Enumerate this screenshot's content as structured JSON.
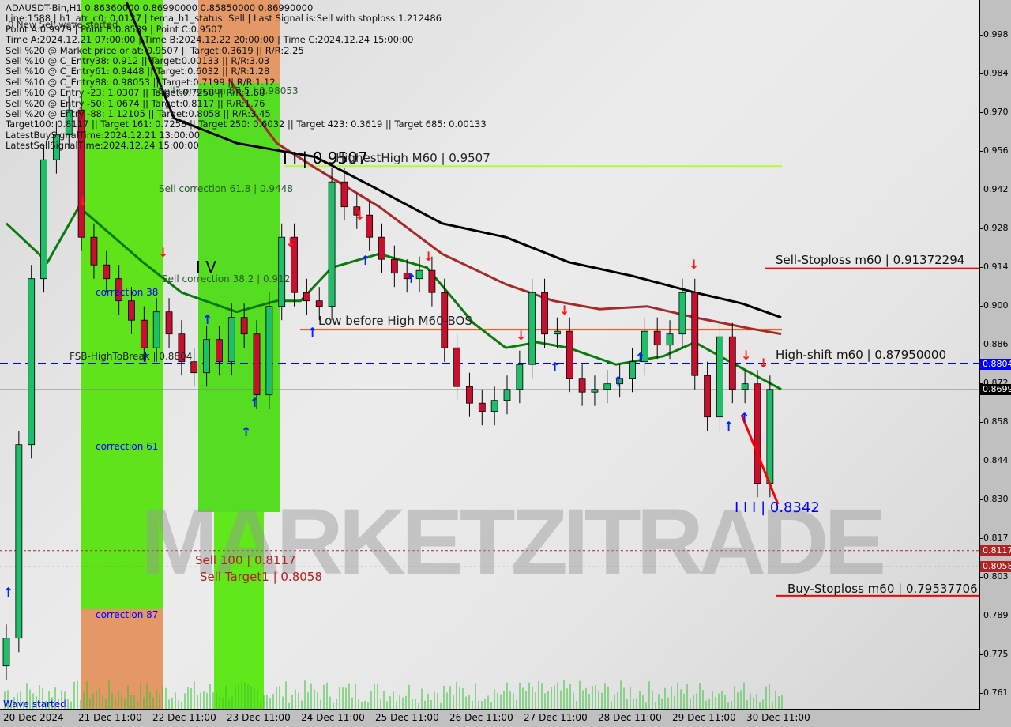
{
  "info_panel": [
    "ADAUSDT-Bin,H1  0.86360000 0.86990000 0.85850000 0.86990000",
    "Line:1588 | h1_atr_c0: 0.0127 | tema_h1_status: Sell | Last Signal is:Sell with stoploss:1.212486",
    "Point A:0.9979 | Point B:0.8589 | Point C:0.9507",
    "Time A:2024.12.21 07:00:00 | Time B:2024.12.22 20:00:00 | Time C:2024.12.24 15:00:00",
    "Sell %20 @ Market price or at: 0.9507 || Target:0.3619 || R/R:2.25",
    "Sell %10 @ C_Entry38: 0.912 || Target:0.00133 || R/R:3.03",
    "Sell %10 @ C_Entry61: 0.9448 || Target:0.6032 || R/R:1.28",
    "Sell %10 @ C_Entry88: 0.98053 || Target:0.7199 || R/R:1.12",
    "Sell %10 @ Entry -23: 1.0307 || Target:0.7258 || R/R:1.68",
    "Sell %20 @ Entry -50: 1.0674 || Target:0.8117 || R/R:1.76",
    "Sell %20 @ Entry -88: 1.12105 || Target:0.8058 || R/R:3.45",
    "Target100: 0.8117 || Target 161: 0.7258 || Target 250: 0.6032 || Target 423: 0.3619 || Target 685: 0.00133",
    "LatestBuySignalTime:2024.12.21 13:00:00",
    "LatestSellSignalTime:2024.12.24 15:00:00"
  ],
  "overlay_labels": {
    "new_sell_wave": "0 New Sell wave started",
    "sell_correction_88": "Sell correction 87.5 | 0.98053",
    "sell_correction_618": "Sell correction 61.8 | 0.9448",
    "sell_correction_382": "Sell correction 38.2 | 0.912",
    "correction_38": "correction 38",
    "correction_61": "correction 61",
    "correction_87": "correction 87",
    "wave_started": "Wave started",
    "fsb_high": "FSB-HighToBreak | 0.8804",
    "wave_iv": "I V",
    "point_c": "I I | 0.9507",
    "highest_high": "HighestHigh   M60 | 0.9507",
    "low_before_high": "Low before High   M60-BOS",
    "sell_stoploss": "Sell-Stoploss m60 | 0.91372294",
    "high_shift": "High-shift m60 | 0.87950000",
    "buy_stoploss": "Buy-Stoploss m60 | 0.79537706",
    "sell_100": "Sell 100 | 0.8117",
    "sell_target1": "Sell Target1 | 0.8058",
    "wave_iii": "I I I | 0.8342",
    "watermark": "MARKETZITRADE"
  },
  "price_badges": {
    "high_shift": "0.8804",
    "current": "0.8699",
    "sell_100": "0.8117",
    "sell_target1": "0.8058"
  },
  "colors": {
    "bull": "#1fbf6a",
    "bear": "#c8102e",
    "ma_fast": "#0a7a0a",
    "ma_mid": "#a52a2a",
    "ma_slow": "#000000",
    "zone_green": "#5fe31a",
    "zone_orange": "#e39866",
    "stoploss": "#ff0000",
    "high_shift": "#0000ff",
    "bos": "#ff4500",
    "m60": "#adff2f",
    "target": "#b22222"
  },
  "chart_data": {
    "type": "candlestick",
    "symbol": "ADAUSDT-Bin",
    "timeframe": "H1",
    "ylim": [
      0.761,
      1.005
    ],
    "y_ticks": [
      "0.998",
      "0.984",
      "0.970",
      "0.956",
      "0.942",
      "0.928",
      "0.914",
      "0.900",
      "0.886",
      "0.872",
      "0.858",
      "0.844",
      "0.830",
      "0.817",
      "0.803",
      "0.789",
      "0.775",
      "0.761"
    ],
    "x_ticks": [
      "20 Dec 2024",
      "21 Dec 11:00",
      "22 Dec 11:00",
      "23 Dec 11:00",
      "24 Dec 11:00",
      "25 Dec 11:00",
      "26 Dec 11:00",
      "27 Dec 11:00",
      "28 Dec 11:00",
      "29 Dec 11:00",
      "30 Dec 11:00"
    ],
    "closes": [
      0.78,
      0.85,
      0.91,
      0.953,
      0.962,
      0.971,
      0.925,
      0.915,
      0.91,
      0.902,
      0.895,
      0.885,
      0.898,
      0.89,
      0.88,
      0.876,
      0.888,
      0.88,
      0.896,
      0.89,
      0.868,
      0.9,
      0.925,
      0.905,
      0.902,
      0.9,
      0.945,
      0.936,
      0.933,
      0.925,
      0.917,
      0.912,
      0.91,
      0.913,
      0.905,
      0.885,
      0.871,
      0.865,
      0.862,
      0.866,
      0.87,
      0.879,
      0.905,
      0.89,
      0.891,
      0.874,
      0.869,
      0.87,
      0.872,
      0.874,
      0.88,
      0.891,
      0.886,
      0.89,
      0.905,
      0.875,
      0.86,
      0.889,
      0.87,
      0.872,
      0.836,
      0.87
    ],
    "last_ohlc": {
      "open": 0.8636,
      "high": 0.8699,
      "low": 0.8585,
      "close": 0.8699
    },
    "moving_averages": [
      {
        "color": "#0a7a0a",
        "points": [
          [
            0,
            0.93
          ],
          [
            3.3,
            0.916
          ],
          [
            5.8,
            0.936
          ],
          [
            10.9,
            0.916
          ],
          [
            14,
            0.905
          ],
          [
            18.4,
            0.898
          ],
          [
            21.6,
            0.902
          ],
          [
            23.5,
            0.902
          ],
          [
            26,
            0.914
          ],
          [
            29.8,
            0.919
          ],
          [
            33.6,
            0.914
          ],
          [
            37.3,
            0.894
          ],
          [
            39.9,
            0.885
          ],
          [
            42.4,
            0.887
          ],
          [
            44.9,
            0.885
          ],
          [
            48.7,
            0.879
          ],
          [
            52.5,
            0.882
          ],
          [
            55,
            0.887
          ],
          [
            58.2,
            0.879
          ],
          [
            61.9,
            0.87
          ]
        ]
      },
      {
        "color": "#a52a2a",
        "points": [
          [
            17.8,
            0.982
          ],
          [
            21.6,
            0.959
          ],
          [
            24.7,
            0.95
          ],
          [
            29.8,
            0.936
          ],
          [
            34.8,
            0.919
          ],
          [
            39.9,
            0.908
          ],
          [
            43.7,
            0.902
          ],
          [
            47.4,
            0.899
          ],
          [
            51.2,
            0.9
          ],
          [
            55,
            0.896
          ],
          [
            59.4,
            0.892
          ],
          [
            61.9,
            0.89
          ]
        ]
      },
      {
        "color": "#000000",
        "points": [
          [
            9.6,
            1.01
          ],
          [
            13.4,
            0.968
          ],
          [
            18.4,
            0.959
          ],
          [
            24.7,
            0.954
          ],
          [
            29.8,
            0.942
          ],
          [
            34.8,
            0.93
          ],
          [
            39.9,
            0.925
          ],
          [
            44.9,
            0.916
          ],
          [
            50,
            0.911
          ],
          [
            55,
            0.905
          ],
          [
            58.8,
            0.901
          ],
          [
            61.9,
            0.896
          ]
        ]
      }
    ],
    "levels": [
      {
        "name": "HighestHigh M60",
        "price": 0.9507,
        "color": "#adff2f",
        "style": "solid"
      },
      {
        "name": "Sell-Stoploss m60",
        "price": 0.91372294,
        "color": "#ff0000",
        "style": "solid"
      },
      {
        "name": "Low before High M60-BOS",
        "price": 0.8916,
        "color": "#ff4500",
        "style": "solid"
      },
      {
        "name": "High-shift m60",
        "price": 0.8795,
        "color": "#0000ff",
        "style": "dashed"
      },
      {
        "name": "Current price",
        "price": 0.8699,
        "color": "#808080",
        "style": "solid"
      },
      {
        "name": "Sell 100",
        "price": 0.8117,
        "color": "#b22222",
        "style": "dotted"
      },
      {
        "name": "Sell Target1",
        "price": 0.8058,
        "color": "#b22222",
        "style": "dotted"
      },
      {
        "name": "Buy-Stoploss m60",
        "price": 0.79537706,
        "color": "#ff0000",
        "style": "solid"
      }
    ],
    "grid": false
  }
}
